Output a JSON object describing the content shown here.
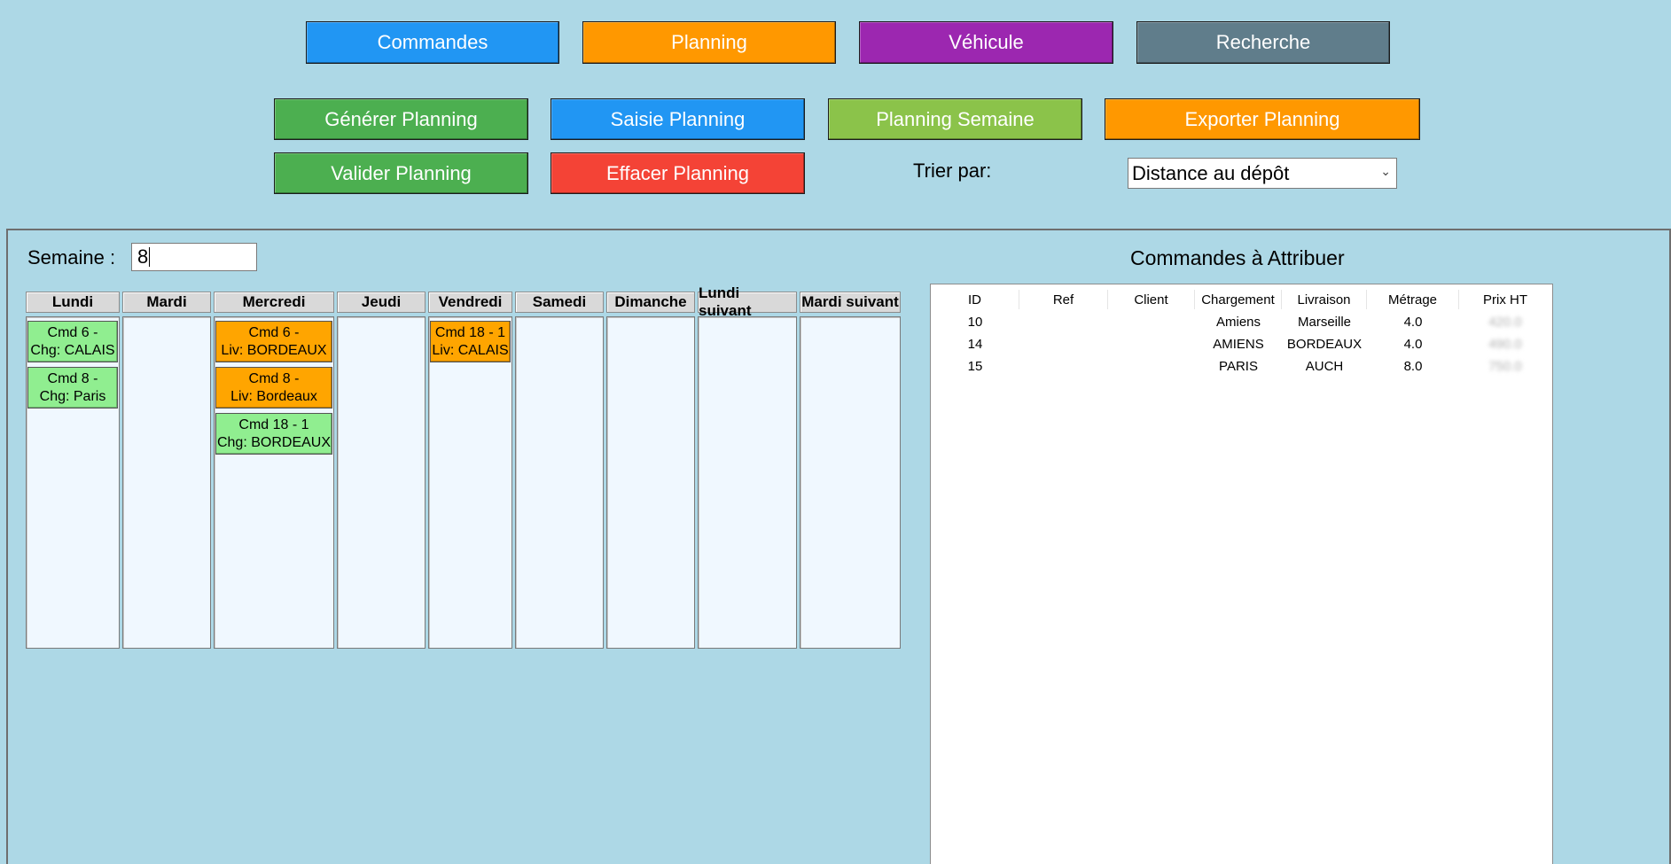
{
  "nav": {
    "commandes": "Commandes",
    "planning": "Planning",
    "vehicule": "Véhicule",
    "recherche": "Recherche"
  },
  "actions": {
    "generer": "Générer Planning",
    "saisie": "Saisie Planning",
    "semaine": "Planning Semaine",
    "exporter": "Exporter Planning",
    "valider": "Valider Planning",
    "effacer": "Effacer Planning"
  },
  "colors": {
    "blue": "#2196f3",
    "orange": "#ff9800",
    "purple": "#9c27b0",
    "grey": "#607d8b",
    "green": "#4caf50",
    "light_green": "#8bc34a",
    "red": "#f44336",
    "card_green": "#90ee90",
    "card_orange": "#ffa500",
    "background": "#add8e6"
  },
  "sort": {
    "label": "Trier par:",
    "selected": "Distance au dépôt"
  },
  "week": {
    "label": "Semaine :",
    "value": "8"
  },
  "days": [
    "Lundi",
    "Mardi",
    "Mercredi",
    "Jeudi",
    "Vendredi",
    "Samedi",
    "Dimanche",
    "Lundi suivant",
    "Mardi suivant"
  ],
  "schedule": {
    "lundi": [
      {
        "line1": "Cmd 6 -",
        "line2": "Chg: CALAIS"
      },
      {
        "line1": "Cmd 8 -",
        "line2": "Chg: Paris"
      }
    ],
    "mercredi": [
      {
        "line1": "Cmd 6 -",
        "line2": "Liv: BORDEAUX"
      },
      {
        "line1": "Cmd 8 -",
        "line2": "Liv: Bordeaux"
      },
      {
        "line1": "Cmd 18 - 1",
        "line2": "Chg: BORDEAUX"
      }
    ],
    "vendredi": [
      {
        "line1": "Cmd 18 - 1",
        "line2": "Liv: CALAIS"
      }
    ]
  },
  "orders": {
    "title": "Commandes à Attribuer",
    "columns": [
      "ID",
      "Ref",
      "Client",
      "Chargement",
      "Livraison",
      "Métrage",
      "Prix HT"
    ],
    "rows": [
      [
        "10",
        "",
        "",
        "Amiens",
        "Marseille",
        "4.0",
        "420.0"
      ],
      [
        "14",
        "",
        "",
        "AMIENS",
        "BORDEAUX",
        "4.0",
        "490.0"
      ],
      [
        "15",
        "",
        "",
        "PARIS",
        "AUCH",
        "8.0",
        "750.0"
      ]
    ]
  }
}
